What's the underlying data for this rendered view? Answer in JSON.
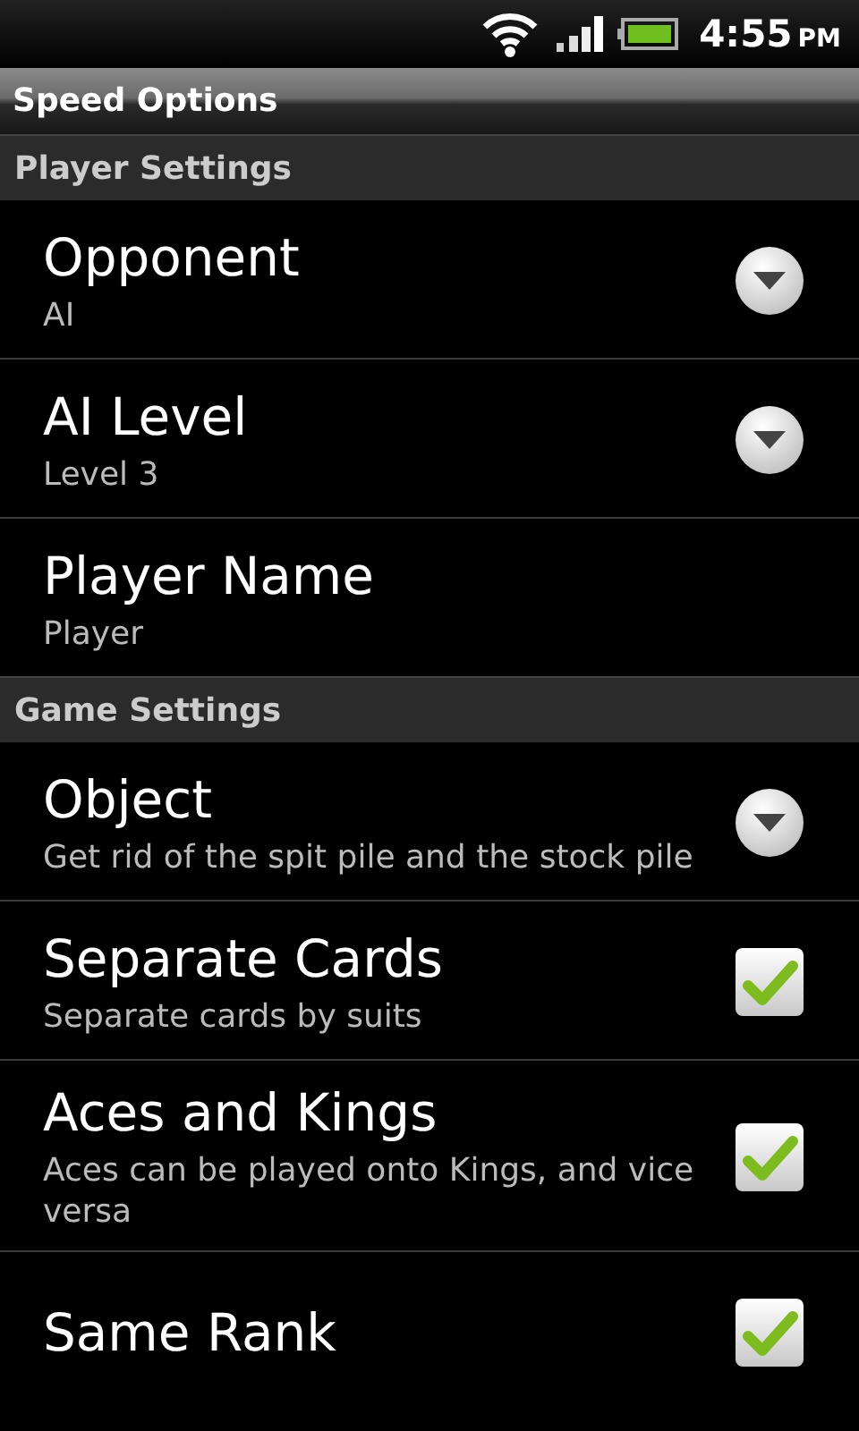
{
  "status_bar": {
    "time": "4:55",
    "ampm": "PM"
  },
  "window": {
    "title": "Speed Options"
  },
  "sections": [
    {
      "title": "Player Settings",
      "items": [
        {
          "kind": "dropdown",
          "title": "Opponent",
          "summary": "AI"
        },
        {
          "kind": "dropdown",
          "title": "AI Level",
          "summary": "Level 3"
        },
        {
          "kind": "text",
          "title": "Player Name",
          "summary": "Player"
        }
      ]
    },
    {
      "title": "Game Settings",
      "items": [
        {
          "kind": "dropdown",
          "title": "Object",
          "summary": "Get rid of the spit pile and the stock pile"
        },
        {
          "kind": "checkbox",
          "title": "Separate Cards",
          "summary": "Separate cards by suits",
          "checked": true
        },
        {
          "kind": "checkbox",
          "title": "Aces and Kings",
          "summary": "Aces can be played onto Kings, and vice versa",
          "checked": true
        },
        {
          "kind": "checkbox",
          "title": "Same Rank",
          "checked": true
        }
      ]
    }
  ]
}
